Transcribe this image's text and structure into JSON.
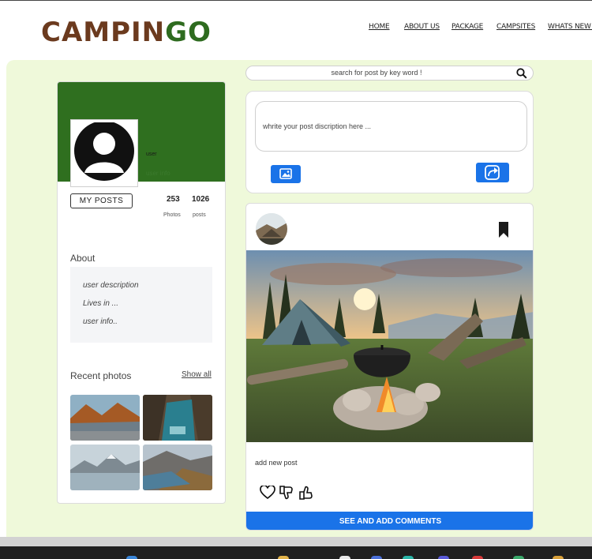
{
  "header": {
    "logo_part1": "CAMPIN",
    "logo_part2": "GO",
    "nav": [
      "HOME",
      "ABOUT US",
      "PACKAGE",
      "CAMPSITES",
      "WHATS NEW ?"
    ]
  },
  "search": {
    "placeholder": "search for post by key word !"
  },
  "profile": {
    "name": "user",
    "info": "user info",
    "my_posts_label": "MY POSTS",
    "photos_count": "253",
    "photos_label": "Photos",
    "posts_count": "1026",
    "posts_label": "posts",
    "about_title": "About",
    "about_lines": [
      "user description",
      "Lives in ...",
      "user info.."
    ],
    "recent_title": "Recent photos",
    "show_all": "Show all"
  },
  "compose": {
    "placeholder": "whrite your post discription here ..."
  },
  "post": {
    "caption": "add new post",
    "comments_button": "SEE AND ADD COMMENTS"
  },
  "colors": {
    "brand_brown": "#6b3a1e",
    "brand_green": "#2e6b1f",
    "page_green": "#eff9da",
    "banner_green": "#2f6f1f",
    "accent_blue": "#1a73e8"
  },
  "icons": {
    "search": "search-icon",
    "image": "image-icon",
    "share": "share-icon",
    "bookmark": "bookmark-icon",
    "heart": "heart-icon",
    "dislike": "thumbs-down-icon",
    "like": "thumbs-up-icon"
  }
}
